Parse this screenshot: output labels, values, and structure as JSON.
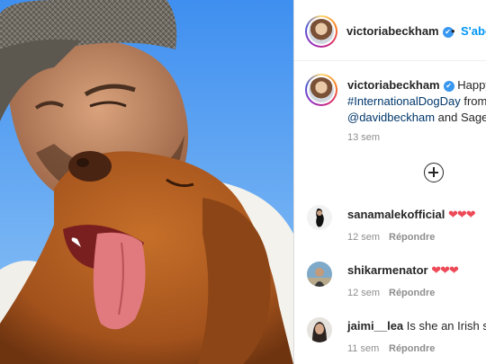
{
  "post": {
    "username": "victoriabeckham",
    "follow_label": "S'abo",
    "separator": "•",
    "caption": {
      "intro": "Happy",
      "line2_tag": "#InternationalDogDay",
      "line2_rest": " from",
      "line3_mention": "@davidbeckham",
      "line3_rest": " and Sage!"
    },
    "posted_time": "13 sem",
    "verified_icon": "✔",
    "load_more_icon": "plus-circle-icon"
  },
  "comments": [
    {
      "username": "sanamalekofficial",
      "text": "❤❤❤",
      "time": "12 sem",
      "reply_label": "Répondre"
    },
    {
      "username": "shikarmenator",
      "text": "❤❤❤",
      "time": "12 sem",
      "reply_label": "Répondre"
    },
    {
      "username": "jaimi__lea",
      "text": "Is she an Irish se",
      "time": "11 sem",
      "reply_label": "Répondre"
    }
  ],
  "colors": {
    "accent": "#0095f6",
    "verified": "#3897f0",
    "heart": "#ed4956",
    "muted": "#8e8e8e"
  }
}
